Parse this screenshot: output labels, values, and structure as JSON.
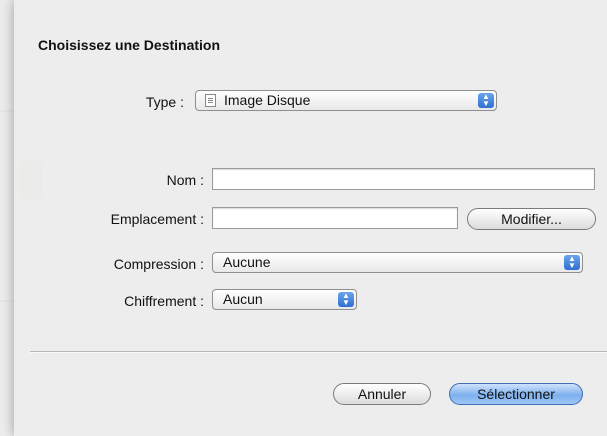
{
  "dialog": {
    "title": "Choisissez une Destination",
    "type_label": "Type :",
    "type_value": "Image Disque",
    "nom_label": "Nom :",
    "nom_value": "",
    "emplacement_label": "Emplacement :",
    "emplacement_value": "",
    "modifier_label": "Modifier...",
    "compression_label": "Compression :",
    "compression_value": "Aucune",
    "chiffrement_label": "Chiffrement :",
    "chiffrement_value": "Aucun",
    "cancel_label": "Annuler",
    "select_label": "Sélectionner"
  },
  "icons": {
    "type_popup": "document-icon",
    "popup_arrows": "stepper-arrows-icon"
  },
  "colors": {
    "default_button": "#7fb1ee",
    "stepper": "#2f6fd2"
  }
}
